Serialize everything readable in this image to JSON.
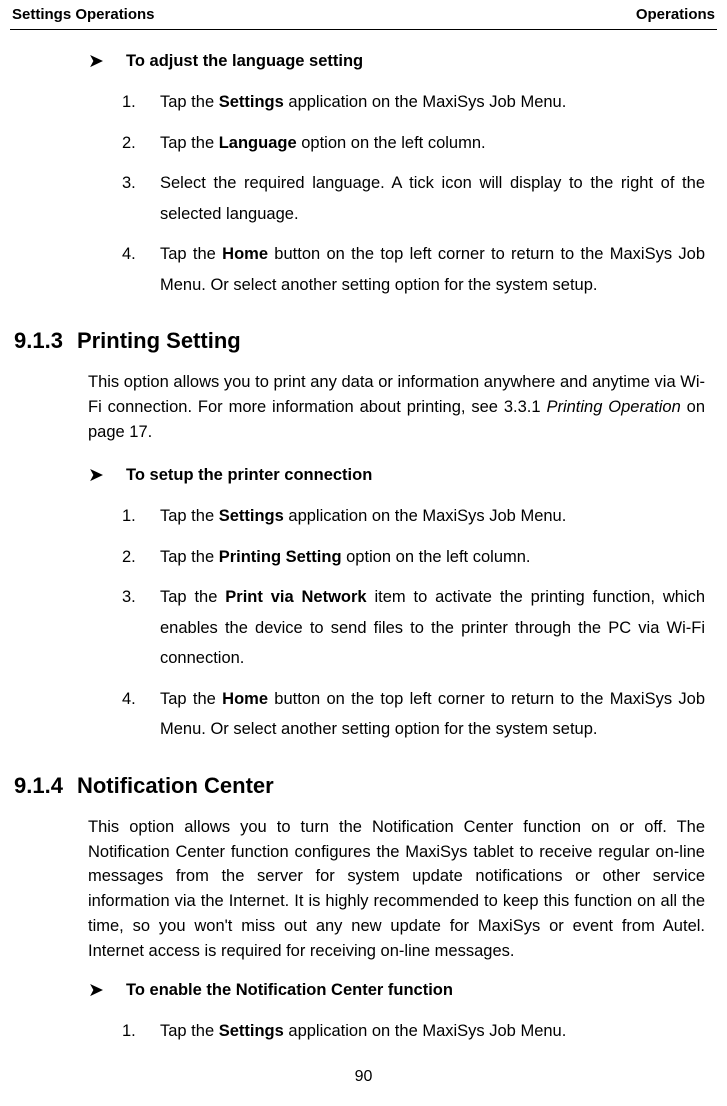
{
  "header": {
    "left": "Settings Operations",
    "right": "Operations"
  },
  "sectionA": {
    "bullet": "➤",
    "title": "To adjust the language setting",
    "items": [
      {
        "n": "1.",
        "pre": "Tap the ",
        "b": "Settings",
        "post": " application on the MaxiSys Job Menu."
      },
      {
        "n": "2.",
        "pre": "Tap the ",
        "b": "Language",
        "post": " option on the left column."
      },
      {
        "n": "3.",
        "plain": "Select the required language. A tick icon will display to the right of the selected language."
      },
      {
        "n": "4.",
        "pre": "Tap the ",
        "b": "Home",
        "post": " button on the top left corner to return to the MaxiSys Job Menu. Or select another setting option for the system setup."
      }
    ]
  },
  "section913": {
    "num": "9.1.3",
    "title": "Printing Setting",
    "para_pre": "This option allows you to print any data or information anywhere and anytime via Wi-Fi connection. For more information about printing, see 3.3.1 ",
    "para_ital": "Printing Operation",
    "para_post": " on page 17.",
    "bullet": "➤",
    "bulletTitle": "To setup the printer connection",
    "items": [
      {
        "n": "1.",
        "pre": "Tap the ",
        "b": "Settings",
        "post": " application on the MaxiSys Job Menu."
      },
      {
        "n": "2.",
        "pre": "Tap the ",
        "b": "Printing Setting",
        "post": " option on the left column."
      },
      {
        "n": "3.",
        "pre": "Tap the ",
        "b": "Print via Network",
        "post": " item to activate the printing function, which enables the device to send files to the printer through the PC via Wi-Fi connection."
      },
      {
        "n": "4.",
        "pre": "Tap the ",
        "b": "Home",
        "post": " button on the top left corner to return to the MaxiSys Job Menu. Or select another setting option for the system setup."
      }
    ]
  },
  "section914": {
    "num": "9.1.4",
    "title": "Notification Center",
    "para": "This option allows you to turn the Notification Center function on or off. The Notification Center function configures the MaxiSys tablet to receive regular on-line messages from the server for system update notifications or other service information via the Internet. It is highly recommended to keep this function on all the time, so you won't miss out any new update for MaxiSys or event from Autel. Internet access is required for receiving on-line messages.",
    "bullet": "➤",
    "bulletTitle": "To enable the Notification Center function",
    "items": [
      {
        "n": "1.",
        "pre": "Tap the ",
        "b": "Settings",
        "post": " application on the MaxiSys Job Menu."
      }
    ]
  },
  "pageNumber": "90"
}
